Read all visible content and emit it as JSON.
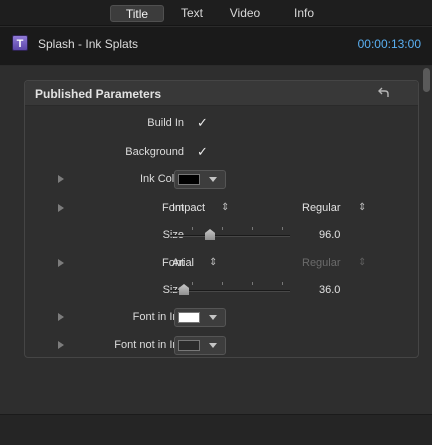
{
  "tabs": [
    {
      "label": "Title",
      "active": true
    },
    {
      "label": "Text",
      "active": false
    },
    {
      "label": "Video",
      "active": false
    },
    {
      "label": "Info",
      "active": false
    }
  ],
  "header": {
    "icon_letter": "T",
    "clip_name": "Splash - Ink Splats",
    "timecode": "00:00:13:00"
  },
  "panel": {
    "title": "Published Parameters",
    "reset_icon": "reset-arrow-icon"
  },
  "params": {
    "build_in": {
      "label": "Build In",
      "checked": "✓"
    },
    "background": {
      "label": "Background",
      "checked": "✓"
    },
    "ink_color": {
      "label": "Ink Color",
      "color": "#000000"
    },
    "font1": {
      "label": "Font",
      "family": "Impact",
      "style": "Regular"
    },
    "size1": {
      "label": "Size",
      "value": "96.0",
      "fraction": 0.33
    },
    "font2": {
      "label": "Font",
      "family": "Arial",
      "style": "Regular"
    },
    "size2": {
      "label": "Size",
      "value": "36.0",
      "fraction": 0.12
    },
    "font_in_ink": {
      "label": "Font in Ink",
      "color": "#ffffff"
    },
    "font_not_in_ink": {
      "label": "Font not in Ink",
      "color": "#2b2b2b"
    }
  },
  "colors": {
    "accent_timecode": "#5ab0f2"
  }
}
